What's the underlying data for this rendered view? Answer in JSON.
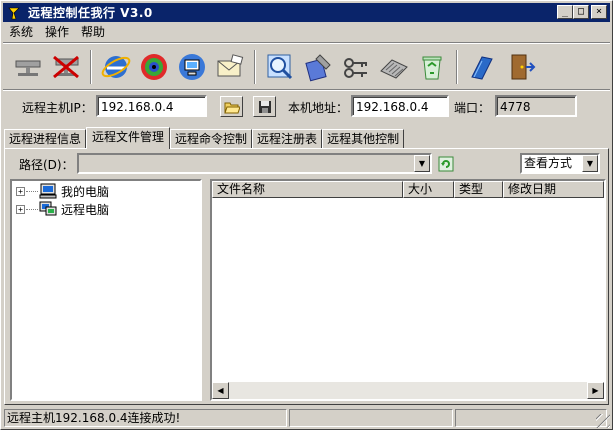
{
  "window": {
    "title": "远程控制任我行 V3.0",
    "controls": {
      "minimize": "_",
      "maximize": "□",
      "close": "×"
    }
  },
  "menu": [
    "系统",
    "操作",
    "帮助"
  ],
  "toolbar": {
    "buttons": [
      {
        "name": "connect-host-icon"
      },
      {
        "name": "disconnect-host-icon"
      },
      {
        "name": "internet-explorer-icon"
      },
      {
        "name": "eye-monitor-icon"
      },
      {
        "name": "network-computer-icon"
      },
      {
        "name": "mail-envelope-icon"
      },
      {
        "name": "magnifier-search-icon"
      },
      {
        "name": "tools-icon"
      },
      {
        "name": "keys-icon"
      },
      {
        "name": "keyboard-icon"
      },
      {
        "name": "recycle-bin-icon"
      },
      {
        "name": "help-book-icon"
      },
      {
        "name": "exit-door-icon"
      }
    ]
  },
  "address": {
    "remote_ip_label": "远程主机IP：",
    "remote_ip_value": "192.168.0.4",
    "local_addr_label": "本机地址：",
    "local_addr_value": "192.168.0.4",
    "port_label": "端口：",
    "port_value": "4778"
  },
  "tabs": [
    "远程进程信息",
    "远程文件管理",
    "远程命令控制",
    "远程注册表",
    "远程其他控制"
  ],
  "active_tab": 1,
  "path": {
    "label": "路径(D)：",
    "value": "",
    "view_mode": "查看方式"
  },
  "tree": [
    {
      "label": "我的电脑",
      "icon": "my-computer-icon"
    },
    {
      "label": "远程电脑",
      "icon": "remote-computer-icon"
    }
  ],
  "file_columns": [
    "文件名称",
    "大小",
    "类型",
    "修改日期"
  ],
  "status": {
    "message": "远程主机192.168.0.4连接成功!",
    "panel2": "",
    "panel3": ""
  }
}
